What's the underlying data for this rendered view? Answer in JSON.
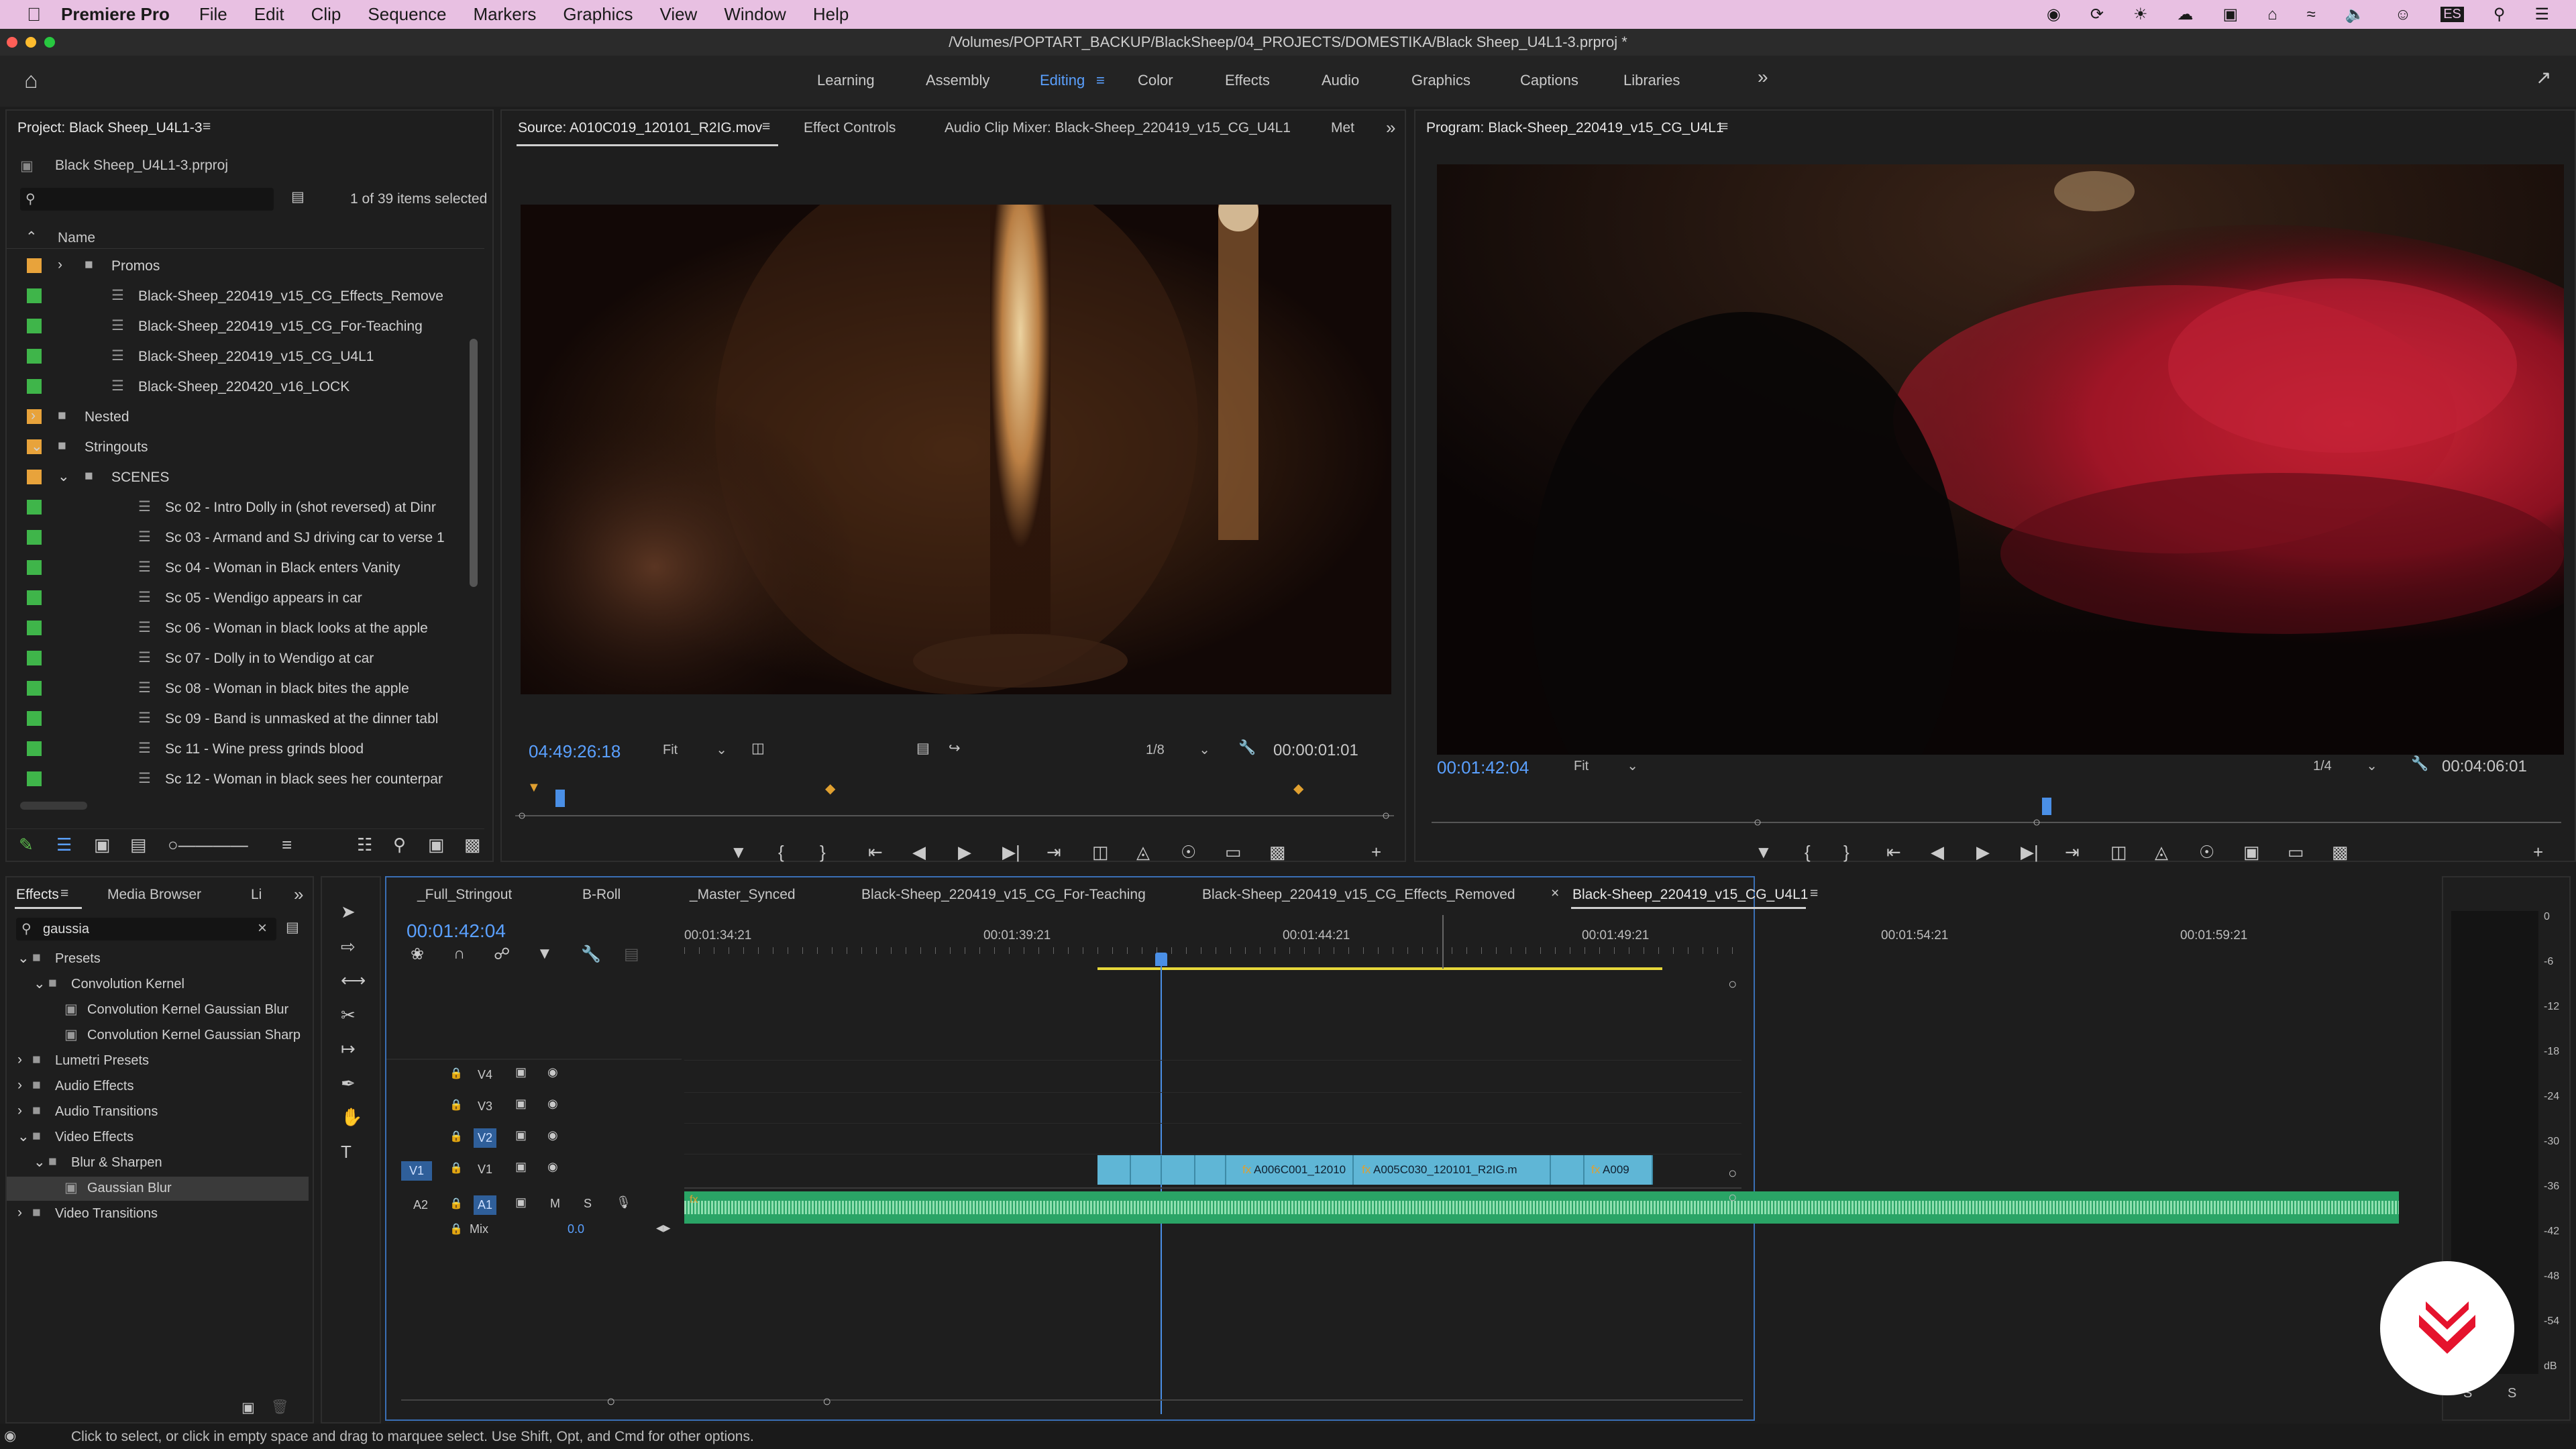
{
  "menubar": {
    "app": "Premiere Pro",
    "items": [
      "File",
      "Edit",
      "Clip",
      "Sequence",
      "Markers",
      "Graphics",
      "View",
      "Window",
      "Help"
    ],
    "input_source": "ES"
  },
  "title": "/Volumes/POPTART_BACKUP/BlackSheep/04_PROJECTS/DOMESTIKA/Black Sheep_U4L1-3.prproj *",
  "workspaces": [
    "Learning",
    "Assembly",
    "Editing",
    "Color",
    "Effects",
    "Audio",
    "Graphics",
    "Captions",
    "Libraries"
  ],
  "active_workspace": "Editing",
  "project": {
    "tab": "Project: Black Sheep_U4L1-3",
    "file": "Black Sheep_U4L1-3.prproj",
    "selection": "1 of 39 items selected",
    "col_name": "Name",
    "items": [
      {
        "label": "Promos",
        "type": "folder",
        "indent": 1,
        "color": "#e8a33b",
        "expand": ">"
      },
      {
        "label": "Black-Sheep_220419_v15_CG_Effects_Remove",
        "type": "seq",
        "indent": 2,
        "color": "#3fb54a"
      },
      {
        "label": "Black-Sheep_220419_v15_CG_For-Teaching",
        "type": "seq",
        "indent": 2,
        "color": "#3fb54a"
      },
      {
        "label": "Black-Sheep_220419_v15_CG_U4L1",
        "type": "seq",
        "indent": 2,
        "color": "#3fb54a"
      },
      {
        "label": "Black-Sheep_220420_v16_LOCK",
        "type": "seq",
        "indent": 2,
        "color": "#3fb54a"
      },
      {
        "label": "Nested",
        "type": "folder",
        "indent": 0,
        "color": "#e8a33b",
        "expand": ">"
      },
      {
        "label": "Stringouts",
        "type": "folder",
        "indent": 0,
        "color": "#e8a33b",
        "expand": "v"
      },
      {
        "label": "SCENES",
        "type": "folder",
        "indent": 1,
        "color": "#e8a33b",
        "expand": "v"
      },
      {
        "label": "Sc 02 - Intro Dolly in (shot reversed) at Dinr",
        "type": "seq",
        "indent": 3,
        "color": "#3fb54a"
      },
      {
        "label": "Sc 03 - Armand and SJ driving car to verse 1",
        "type": "seq",
        "indent": 3,
        "color": "#3fb54a"
      },
      {
        "label": "Sc 04 - Woman in Black enters Vanity",
        "type": "seq",
        "indent": 3,
        "color": "#3fb54a"
      },
      {
        "label": "Sc 05 - Wendigo appears in car",
        "type": "seq",
        "indent": 3,
        "color": "#3fb54a"
      },
      {
        "label": "Sc 06 - Woman in black looks at the apple",
        "type": "seq",
        "indent": 3,
        "color": "#3fb54a"
      },
      {
        "label": "Sc 07 - Dolly in to Wendigo at car",
        "type": "seq",
        "indent": 3,
        "color": "#3fb54a"
      },
      {
        "label": "Sc 08 - Woman in black bites the apple",
        "type": "seq",
        "indent": 3,
        "color": "#3fb54a"
      },
      {
        "label": "Sc 09 - Band is unmasked at the dinner tabl",
        "type": "seq",
        "indent": 3,
        "color": "#3fb54a"
      },
      {
        "label": "Sc 11 - Wine press grinds blood",
        "type": "seq",
        "indent": 3,
        "color": "#3fb54a"
      },
      {
        "label": "Sc 12 - Woman in black sees her counterpar",
        "type": "seq",
        "indent": 3,
        "color": "#3fb54a"
      }
    ]
  },
  "source": {
    "tabs": [
      "Source: A010C019_120101_R2IG.mov",
      "Effect Controls",
      "Audio Clip Mixer: Black-Sheep_220419_v15_CG_U4L1",
      "Met"
    ],
    "timecode": "04:49:26:18",
    "fit": "Fit",
    "res": "1/8",
    "duration": "00:00:01:01"
  },
  "program": {
    "tab": "Program: Black-Sheep_220419_v15_CG_U4L1",
    "timecode": "00:01:42:04",
    "fit": "Fit",
    "res": "1/4",
    "duration": "00:04:06:01"
  },
  "effects": {
    "tabs": [
      "Effects",
      "Media Browser",
      "Li"
    ],
    "search": "gaussia",
    "tree": [
      {
        "label": "Presets",
        "indent": 0,
        "expand": "v"
      },
      {
        "label": "Convolution Kernel",
        "indent": 1,
        "expand": "v"
      },
      {
        "label": "Convolution Kernel Gaussian Blur",
        "indent": 2,
        "expand": ""
      },
      {
        "label": "Convolution Kernel Gaussian Sharp",
        "indent": 2,
        "expand": ""
      },
      {
        "label": "Lumetri Presets",
        "indent": 0,
        "expand": ">"
      },
      {
        "label": "Audio Effects",
        "indent": 0,
        "expand": ">"
      },
      {
        "label": "Audio Transitions",
        "indent": 0,
        "expand": ">"
      },
      {
        "label": "Video Effects",
        "indent": 0,
        "expand": "v"
      },
      {
        "label": "Blur & Sharpen",
        "indent": 1,
        "expand": "v"
      },
      {
        "label": "Gaussian Blur",
        "indent": 2,
        "expand": "",
        "selected": true
      },
      {
        "label": "Video Transitions",
        "indent": 0,
        "expand": ">"
      }
    ]
  },
  "timeline": {
    "tabs": [
      "_Full_Stringout",
      "B-Roll",
      "_Master_Synced",
      "Black-Sheep_220419_v15_CG_For-Teaching",
      "Black-Sheep_220419_v15_CG_Effects_Removed",
      "Black-Sheep_220419_v15_CG_U4L1"
    ],
    "timecode": "00:01:42:04",
    "ruler": [
      "00:01:34:21",
      "00:01:39:21",
      "00:01:44:21",
      "00:01:49:21",
      "00:01:54:21",
      "00:01:59:21"
    ],
    "tracks": {
      "video": [
        "V4",
        "V3",
        "V2",
        "V1"
      ],
      "audio": [
        "A1"
      ],
      "src_v": "V1",
      "src_a": "A2",
      "mix_label": "Mix",
      "mix_value": "0.0",
      "m": "M",
      "s": "S"
    },
    "clips": [
      "A006C001_12010",
      "A005C030_120101_R2IG.m",
      "A009"
    ]
  },
  "meter": {
    "scale": [
      "0",
      "-6",
      "-12",
      "-18",
      "-24",
      "-30",
      "-36",
      "-42",
      "-48",
      "-54",
      "dB"
    ],
    "solo": [
      "S",
      "S"
    ]
  },
  "status": "Click to select, or click in empty space and drag to marquee select. Use Shift, Opt, and Cmd for other options."
}
